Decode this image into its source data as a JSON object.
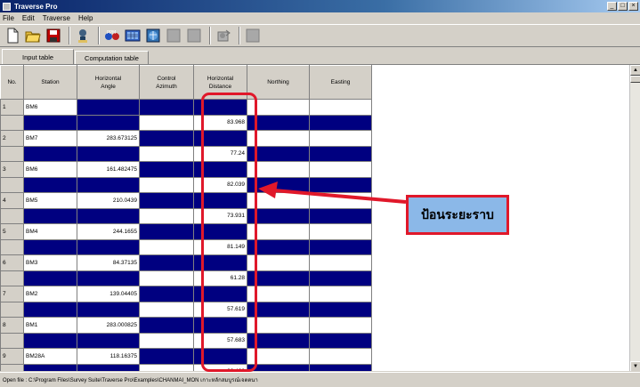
{
  "window": {
    "title": "Traverse Pro"
  },
  "menu": [
    "File",
    "Edit",
    "Traverse",
    "Help"
  ],
  "toolbar": {
    "icons": [
      "new-file-icon",
      "open-folder-icon",
      "save-icon",
      "wizard-icon",
      "ppm-icon",
      "calculator-icon",
      "globe-icon",
      "disabled-icon",
      "disabled-icon",
      "export-icon",
      "disabled-icon"
    ]
  },
  "tabs": [
    "Input table",
    "Computation table"
  ],
  "columns": {
    "no": "No.",
    "station": "Station",
    "hangle": [
      "Horizontal",
      "Angle"
    ],
    "control": [
      "Control",
      "Azimuth"
    ],
    "hdist": [
      "Horizontal",
      "Distance"
    ],
    "northing": "Northing",
    "easting": "Easting"
  },
  "rows": [
    {
      "no": "1",
      "station": "BM6",
      "angle": "",
      "distance": "83.968"
    },
    {
      "no": "2",
      "station": "BM7",
      "angle": "283.673125",
      "distance": "77.24"
    },
    {
      "no": "3",
      "station": "BM6",
      "angle": "161.482475",
      "distance": "82.039"
    },
    {
      "no": "4",
      "station": "BM5",
      "angle": "210.0439",
      "distance": "73.931"
    },
    {
      "no": "5",
      "station": "BM4",
      "angle": "244.1655",
      "distance": "81.149"
    },
    {
      "no": "6",
      "station": "BM3",
      "angle": "84.37135",
      "distance": "61.28"
    },
    {
      "no": "7",
      "station": "BM2",
      "angle": "139.04405",
      "distance": "57.619"
    },
    {
      "no": "8",
      "station": "BM1",
      "angle": "283.000825",
      "distance": "57.683"
    },
    {
      "no": "9",
      "station": "BM28A",
      "angle": "118.16375",
      "distance": "32.408"
    }
  ],
  "status": "Open file : C:\\Program Files\\Survey Suite\\Traverse Pro\\Examples\\CHANMAI_MON เกาะหลักสมบูรณ์เจตตนา",
  "annotation": {
    "callout_text": "ป้อนระยะราบ"
  },
  "colors": {
    "dark_cell": "#000080",
    "highlight": "#e0182a",
    "callout_bg": "#8bb8e8"
  }
}
